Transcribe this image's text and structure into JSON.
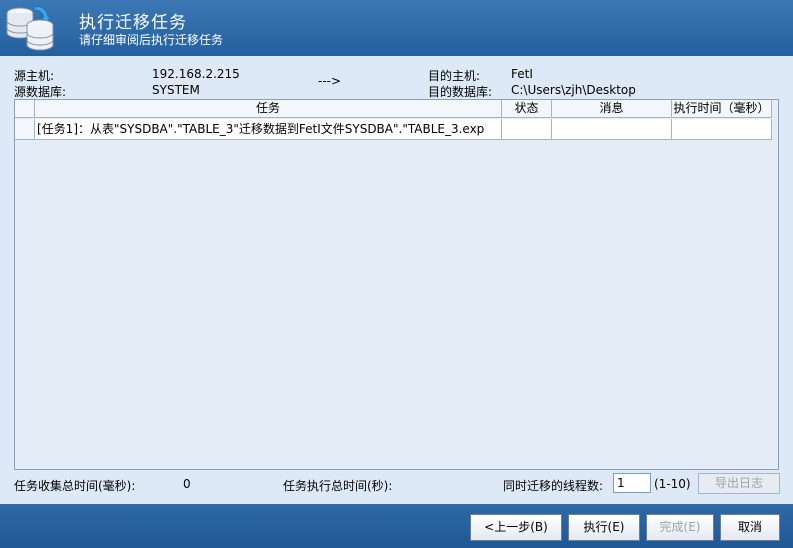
{
  "header": {
    "title": "执行迁移任务",
    "subtitle": "请仔细审阅后执行迁移任务",
    "logo_icon": "database-migrate-icon"
  },
  "info": {
    "source_host_label": "源主机:",
    "source_host_value": "192.168.2.215",
    "source_db_label": "源数据库:",
    "source_db_value": "SYSTEM",
    "arrow": "--->",
    "target_host_label": "目的主机:",
    "target_host_value": "FetI",
    "target_db_label": "目的数据库:",
    "target_db_value": "C:\\Users\\zjh\\Desktop"
  },
  "table": {
    "columns": [
      "任务",
      "状态",
      "消息",
      "执行时间（毫秒）"
    ],
    "rows": [
      {
        "task": "[任务1]：从表\"SYSDBA\".\"TABLE_3\"迁移数据到FetI文件SYSDBA\".\"TABLE_3.exp",
        "status": "",
        "message": "",
        "time": ""
      }
    ]
  },
  "stats": {
    "collect_time_label": "任务收集总时间(毫秒):",
    "collect_time_value": "0",
    "exec_time_label": "任务执行总时间(秒):",
    "threads_label": "同时迁移的线程数:",
    "threads_value": "1",
    "threads_range": "(1-10)",
    "export_log": "导出日志"
  },
  "footer": {
    "prev": "<上一步(B)",
    "execute": "执行(E)",
    "finish": "完成(E)",
    "cancel": "取消"
  }
}
